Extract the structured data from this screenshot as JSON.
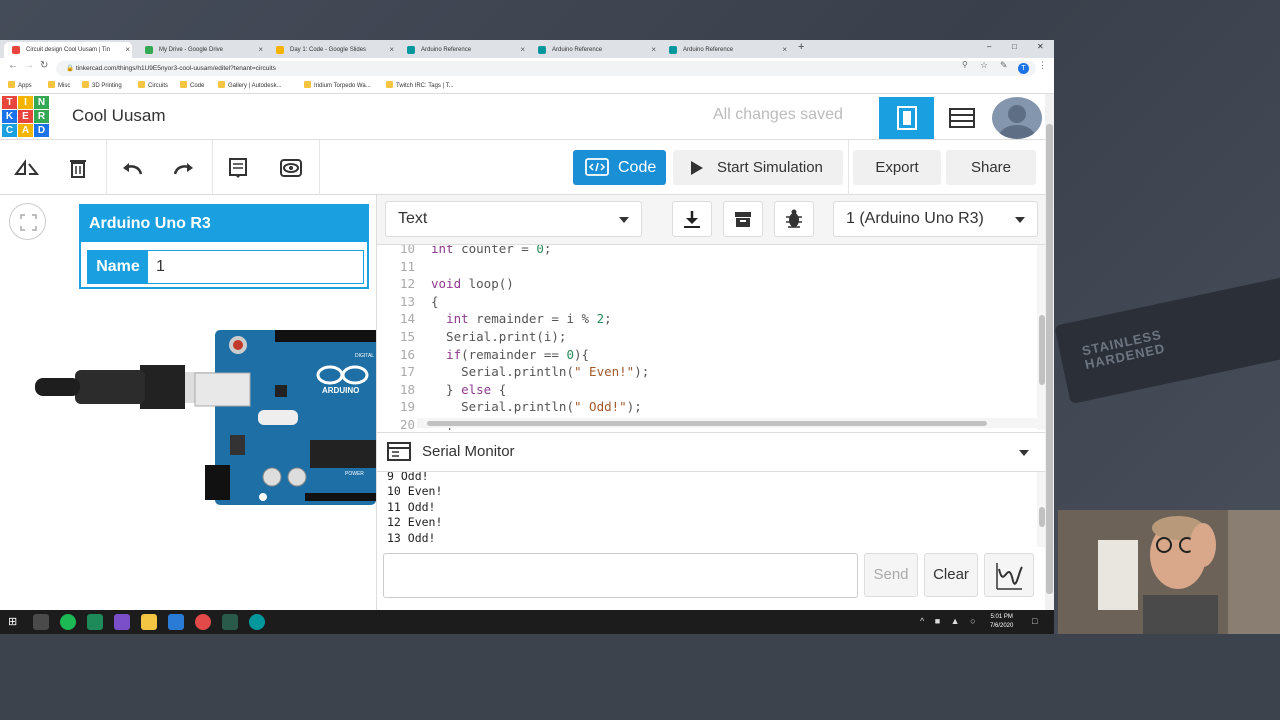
{
  "browser": {
    "tabs": [
      {
        "title": "Circuit design Cool Uusam | Tin",
        "color": "#e8453c",
        "active": true
      },
      {
        "title": "My Drive - Google Drive",
        "color": "#34a853",
        "active": false
      },
      {
        "title": "Day 1: Code - Google Slides",
        "color": "#f4b400",
        "active": false
      },
      {
        "title": "Arduino Reference",
        "color": "#00979d",
        "active": false
      },
      {
        "title": "Arduino Reference",
        "color": "#00979d",
        "active": false
      },
      {
        "title": "Arduino Reference",
        "color": "#00979d",
        "active": false
      }
    ],
    "url": "tinkercad.com/things/h1U9E5nyor3-cool-uusam/editel?tenant=circuits",
    "profile_initial": "T",
    "bookmarks": [
      "Apps",
      "Misc",
      "3D Printing",
      "Circuits",
      "Code",
      "Gallery | Autodesk...",
      "Iridium Torpedo Wa...",
      "Twitch IRC: Tags | T..."
    ]
  },
  "app": {
    "logo_letters": [
      "T",
      "I",
      "N",
      "K",
      "E",
      "R",
      "C",
      "A",
      "D"
    ],
    "project_title": "Cool Uusam",
    "save_status": "All changes saved"
  },
  "toolbar": {
    "code_label": "Code",
    "start_sim_label": "Start Simulation",
    "export_label": "Export",
    "share_label": "Share"
  },
  "inspector": {
    "title": "Arduino Uno R3",
    "name_label": "Name",
    "name_value": "1"
  },
  "board": {
    "brand": "ARDUINO",
    "digital_label": "DIGITAL",
    "power_label": "POWER"
  },
  "code_panel": {
    "mode": "Text",
    "device": "1 (Arduino Uno R3)",
    "lines": [
      {
        "n": "10",
        "code": "int counter = 0;"
      },
      {
        "n": "11",
        "code": ""
      },
      {
        "n": "12",
        "code": "void loop()"
      },
      {
        "n": "13",
        "code": "{"
      },
      {
        "n": "14",
        "code": "  int remainder = i % 2;"
      },
      {
        "n": "15",
        "code": "  Serial.print(i);"
      },
      {
        "n": "16",
        "code": "  if(remainder == 0){"
      },
      {
        "n": "17",
        "code": "    Serial.println(\" Even!\");"
      },
      {
        "n": "18",
        "code": "  } else {"
      },
      {
        "n": "19",
        "code": "    Serial.println(\" Odd!\");"
      },
      {
        "n": "20",
        "code": "  }"
      }
    ]
  },
  "serial_monitor": {
    "title": "Serial Monitor",
    "output": [
      "9 Odd!",
      "10 Even!",
      "11 Odd!",
      "12 Even!",
      "13 Odd!"
    ],
    "input_value": "",
    "send_label": "Send",
    "clear_label": "Clear"
  },
  "taskbar": {
    "time": "5:01 PM",
    "date": "7/6/2020"
  },
  "background": {
    "knife_text_1": "STAINLESS",
    "knife_text_2": "HARDENED"
  }
}
